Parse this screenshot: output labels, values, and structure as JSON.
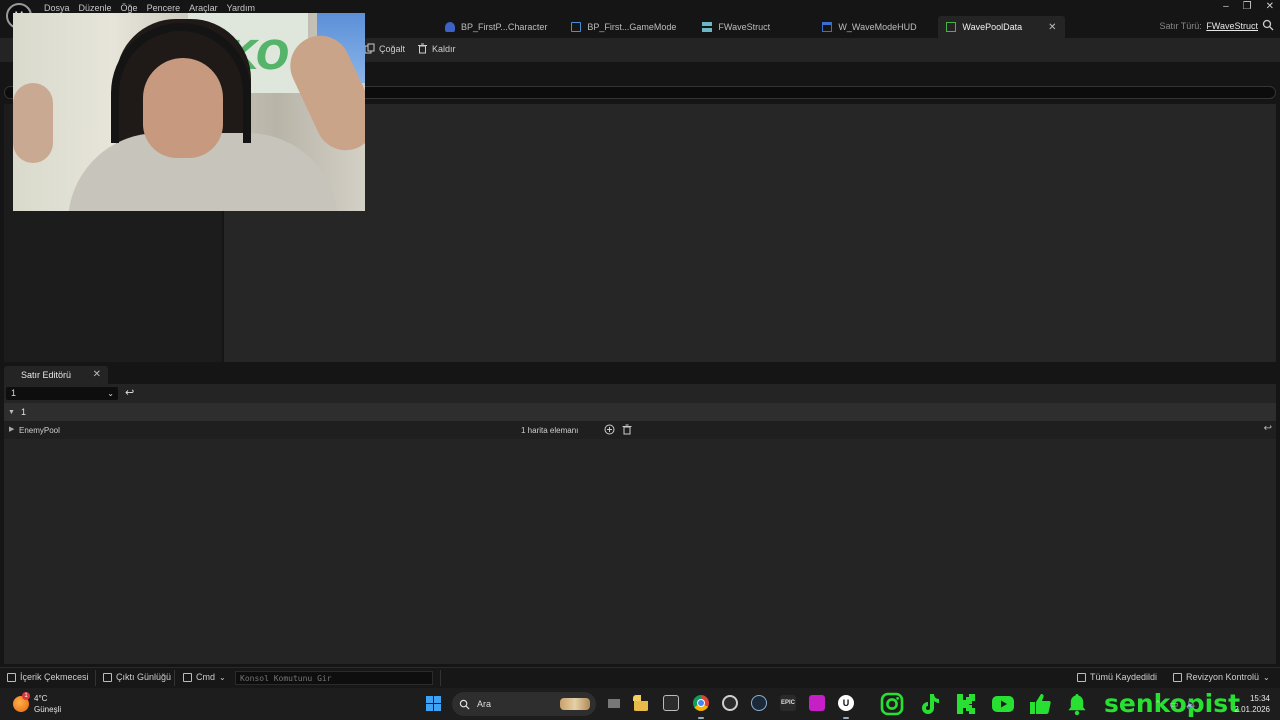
{
  "menu": [
    "Dosya",
    "Düzenle",
    "Öğe",
    "Pencere",
    "Araçlar",
    "Yardım"
  ],
  "tabs": [
    {
      "label": "BP_FirstP...Character",
      "icon": "character-icon"
    },
    {
      "label": "BP_First...GameMode",
      "icon": "blueprint-icon"
    },
    {
      "label": "FWaveStruct",
      "icon": "struct-icon"
    },
    {
      "label": "W_WaveModeHUD",
      "icon": "widget-icon"
    },
    {
      "label": "WavePoolData",
      "icon": "datatable-icon",
      "active": true
    }
  ],
  "row_type": {
    "label": "Satır Türü:",
    "value": "FWaveStruct"
  },
  "toolbar": {
    "duplicate": "Çoğalt",
    "remove": "Kaldır"
  },
  "row_editor": {
    "tab_label": "Satır Editörü",
    "selected_row": "1",
    "category": "1",
    "property": {
      "name": "EnemyPool",
      "value": "1 harita elemanı"
    }
  },
  "statusbar": {
    "content_drawer": "İçerik Çekmecesi",
    "output_log": "Çıktı Günlüğü",
    "cmd": "Cmd",
    "console_placeholder": "Konsol Komutunu Gir",
    "save_all": "Tümü Kaydedildi",
    "revision": "Revizyon Kontrolü"
  },
  "taskbar": {
    "weather_temp": "4°C",
    "weather_desc": "Güneşli",
    "weather_badge": "1",
    "search_label": "Ara",
    "channel": "senkopist",
    "time": "15:34",
    "date": "2.01.2026"
  },
  "colors": {
    "accent_green": "#27e032",
    "panel": "#242424",
    "background": "#151515"
  }
}
